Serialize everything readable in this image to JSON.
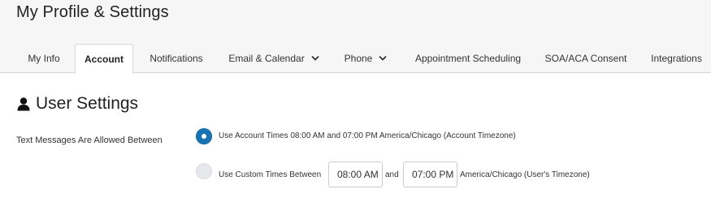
{
  "page": {
    "title": "My Profile & Settings"
  },
  "tabs": [
    {
      "label": "My Info"
    },
    {
      "label": "Account",
      "active": true
    },
    {
      "label": "Notifications"
    },
    {
      "label": "Email & Calendar",
      "has_dropdown": true
    },
    {
      "label": "Phone",
      "has_dropdown": true
    },
    {
      "label": "Appointment Scheduling"
    },
    {
      "label": "SOA/ACA Consent"
    },
    {
      "label": "Integrations"
    }
  ],
  "section": {
    "title": "User Settings",
    "icon": "user-icon"
  },
  "text_messages": {
    "label": "Text Messages Are Allowed Between",
    "option_account": {
      "text": "Use Account Times 08:00 AM and 07:00 PM America/Chicago (Account Timezone)",
      "checked": true
    },
    "option_custom": {
      "text": "Use Custom Times Between",
      "start_value": "08:00 AM",
      "and_text": "and",
      "end_value": "07:00 PM",
      "timezone_text": "America/Chicago (User's Timezone)",
      "checked": false
    }
  },
  "colors": {
    "accent": "#1a73b0",
    "header_bg": "#f6f6f7",
    "border": "#d6d6d9"
  }
}
